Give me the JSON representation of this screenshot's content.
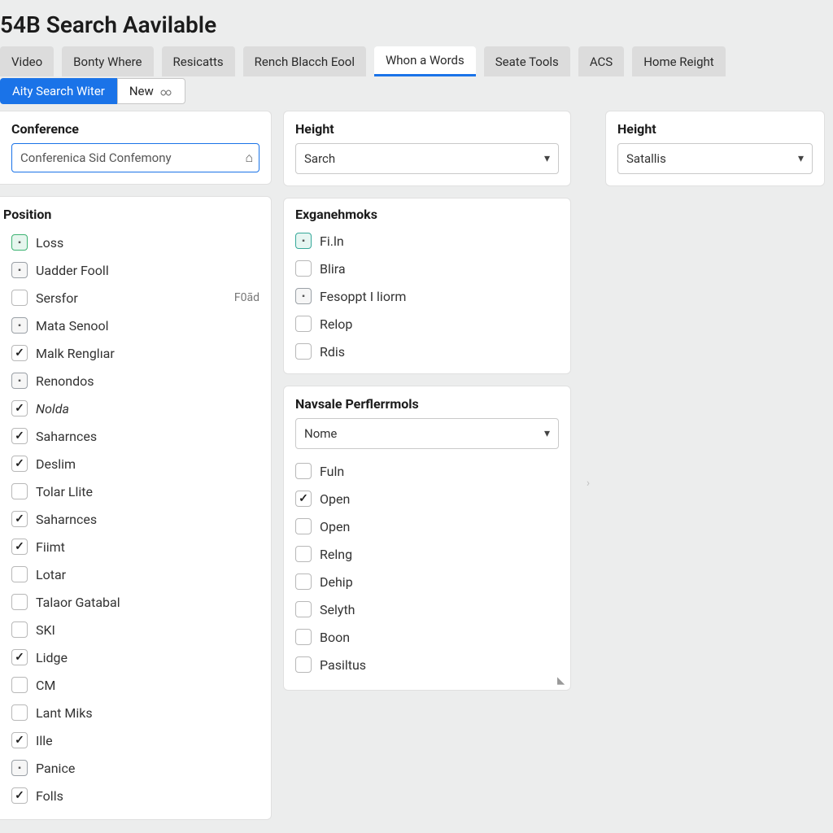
{
  "page_title": "54B Search Aavilable",
  "nav_tabs": [
    "Video",
    "Bonty Where",
    "Resicatts",
    "Rench Blacch Eool",
    "Whon a Words",
    "Seate Tools",
    "ACS",
    "Home Reight"
  ],
  "nav_active_index": 4,
  "sub_tabs": {
    "a": "Aity Search Witer",
    "b": "New"
  },
  "left": {
    "conference": {
      "title": "Conference",
      "value": "Conferenica Sid Confemony"
    },
    "position": {
      "title": "Position",
      "items": [
        {
          "label": "Loss",
          "kind": "badge",
          "variant": "green",
          "checked": false
        },
        {
          "label": "Uadder Fooll",
          "kind": "badge",
          "variant": "gray",
          "checked": false
        },
        {
          "label": "Sersfor",
          "kind": "cb",
          "checked": false,
          "meta": "F0ād"
        },
        {
          "label": "Mata Senool",
          "kind": "badge",
          "variant": "gray",
          "checked": false
        },
        {
          "label": "Malk Renglıar",
          "kind": "cb",
          "checked": true
        },
        {
          "label": "Renondos",
          "kind": "badge",
          "variant": "gray",
          "checked": false
        },
        {
          "label": "Nolda",
          "kind": "cb",
          "checked": true,
          "italic": true
        },
        {
          "label": "Saharnces",
          "kind": "cb",
          "checked": true
        },
        {
          "label": "Deslim",
          "kind": "cb",
          "checked": true
        },
        {
          "label": "Tolar Llite",
          "kind": "cb",
          "checked": false
        },
        {
          "label": "Saharnces",
          "kind": "cb",
          "checked": true
        },
        {
          "label": "Fiimt",
          "kind": "cb",
          "checked": true
        },
        {
          "label": "Lotar",
          "kind": "cb",
          "checked": false
        },
        {
          "label": "Talaor Gatabal",
          "kind": "cb",
          "checked": false
        },
        {
          "label": "SKI",
          "kind": "cb",
          "checked": false
        },
        {
          "label": "Lidge",
          "kind": "cb",
          "checked": true
        },
        {
          "label": "CM",
          "kind": "cb",
          "checked": false
        },
        {
          "label": "Lant Miks",
          "kind": "cb",
          "checked": false
        },
        {
          "label": "Ille",
          "kind": "cb",
          "checked": true
        },
        {
          "label": "Panice",
          "kind": "badge",
          "variant": "gray",
          "checked": false
        },
        {
          "label": "Folls",
          "kind": "cb",
          "checked": true
        }
      ]
    }
  },
  "mid": {
    "height": {
      "title": "Height",
      "value": "Sarch"
    },
    "exg": {
      "title": "Exganehmoks",
      "items": [
        {
          "label": "Fi.ln",
          "kind": "badge",
          "variant": "teal"
        },
        {
          "label": "Blira",
          "kind": "cb",
          "checked": false
        },
        {
          "label": "Fesoppt I liorm",
          "kind": "badge",
          "variant": "gray"
        },
        {
          "label": "Relop",
          "kind": "cb",
          "checked": false
        },
        {
          "label": "Rdis",
          "kind": "cb",
          "checked": false
        }
      ]
    },
    "nav": {
      "title": "Navsale Perflerrmols",
      "select": "Nome",
      "items": [
        {
          "label": "Fuln",
          "checked": false
        },
        {
          "label": "Open",
          "checked": true
        },
        {
          "label": "Open",
          "checked": false
        },
        {
          "label": "Relng",
          "checked": false
        },
        {
          "label": "Dehip",
          "checked": false
        },
        {
          "label": "Selyth",
          "checked": false
        },
        {
          "label": "Boon",
          "checked": false
        },
        {
          "label": "Pasiltus",
          "checked": false
        }
      ]
    }
  },
  "right": {
    "height": {
      "title": "Height",
      "value": "Satallis"
    }
  }
}
